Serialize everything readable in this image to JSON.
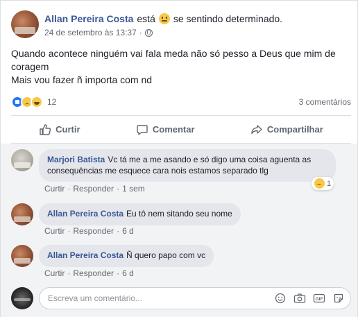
{
  "post": {
    "author": "Allan Pereira Costa",
    "feeling_prefix": "está",
    "feeling_text": "se sentindo determinado.",
    "date": "24 de setembro às 13:37",
    "date_sep": "·",
    "body_lines": [
      "Quando acontece ninguém vai fala meda não só pesso a Deus que mim de coragem",
      "Mais vou fazer ñ importa com nd"
    ],
    "reaction_count": "12",
    "comments_count": "3 comentários"
  },
  "actions": {
    "like": "Curtir",
    "comment": "Comentar",
    "share": "Compartilhar"
  },
  "comments": [
    {
      "author": "Marjori Batista",
      "text": "Vc tá me a me asando e só digo uma coisa aguenta as consequências me esquece cara nois estamos separado tlg",
      "like": "Curtir",
      "reply": "Responder",
      "time": "1 sem",
      "reaction_count": "1"
    },
    {
      "author": "Allan Pereira Costa",
      "text": "Eu tô nem sitando seu nome",
      "like": "Curtir",
      "reply": "Responder",
      "time": "6 d"
    },
    {
      "author": "Allan Pereira Costa",
      "text": "Ñ quero papo com vc",
      "like": "Curtir",
      "reply": "Responder",
      "time": "6 d"
    }
  ],
  "composer": {
    "placeholder": "Escreva um comentário..."
  },
  "meta_sep": "·",
  "colors": {
    "link_blue": "#385898",
    "like_blue": "#2078f4",
    "emoji_yellow": "#f7c84a",
    "muted": "#616770"
  },
  "icons": {
    "feeling": "neutral-face-icon",
    "privacy": "globe-icon",
    "reactions": [
      "like-icon",
      "sad-icon",
      "haha-icon"
    ],
    "composer_tools": [
      "emoji-icon",
      "camera-icon",
      "gif-icon",
      "sticker-icon"
    ]
  }
}
